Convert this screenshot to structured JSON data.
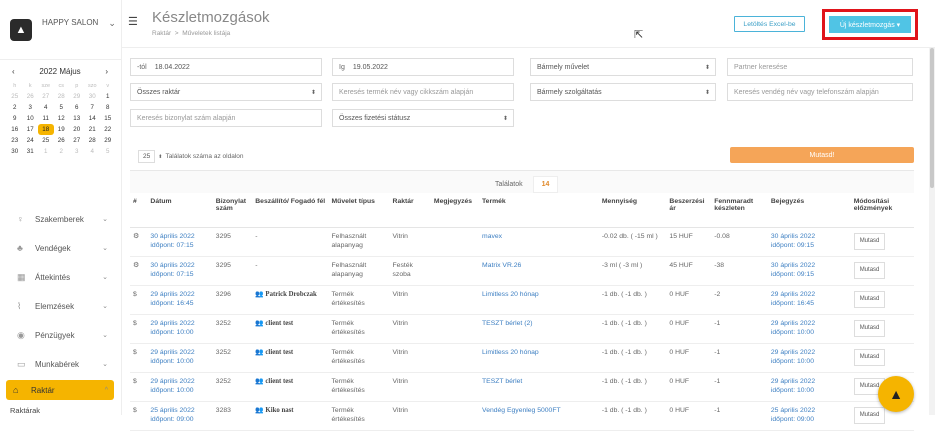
{
  "brand": {
    "name": "HAPPY SALON",
    "chevron": "⌄"
  },
  "calendar": {
    "month": "2022 Május",
    "prev": "‹",
    "next": "›",
    "weekdays": [
      "h",
      "k",
      "sze",
      "cs",
      "p",
      "szo",
      "v"
    ],
    "days": [
      [
        "25",
        "26",
        "27",
        "28",
        "29",
        "30",
        "1"
      ],
      [
        "2",
        "3",
        "4",
        "5",
        "6",
        "7",
        "8"
      ],
      [
        "9",
        "10",
        "11",
        "12",
        "13",
        "14",
        "15"
      ],
      [
        "16",
        "17",
        "18",
        "19",
        "20",
        "21",
        "22"
      ],
      [
        "23",
        "24",
        "25",
        "26",
        "27",
        "28",
        "29"
      ],
      [
        "30",
        "31",
        "1",
        "2",
        "3",
        "4",
        "5"
      ]
    ],
    "selected": "18"
  },
  "nav": [
    {
      "label": "Szakemberek",
      "icon": "person-icon"
    },
    {
      "label": "Vendégek",
      "icon": "group-icon"
    },
    {
      "label": "Áttekintés",
      "icon": "grid-icon"
    },
    {
      "label": "Elemzések",
      "icon": "chart-icon"
    },
    {
      "label": "Pénzügyek",
      "icon": "money-icon"
    },
    {
      "label": "Munkabérek",
      "icon": "wallet-icon"
    },
    {
      "label": "Raktár",
      "icon": "warehouse-icon",
      "active": true
    }
  ],
  "nav_sub": "Raktárak",
  "header": {
    "title": "Készletmozgások",
    "crumb1": "Raktár",
    "crumb_sep": ">",
    "crumb2": "Műveletek listája",
    "excel_btn": "Letöltés Excel-be",
    "new_btn": "Új készletmozgás ▾"
  },
  "filters": {
    "from_label": "-tól",
    "from_value": "18.04.2022",
    "to_label": "Ig",
    "to_value": "19.05.2022",
    "action": "Bármely művelet",
    "partner_ph": "Partner keresése",
    "warehouse": "Összes raktár",
    "product_ph": "Keresés termék név vagy cikkszám alapján",
    "service": "Bármely szolgáltatás",
    "guest_ph": "Keresés vendég név vagy telefonszám alapján",
    "receipt_ph": "Keresés bizonylat szám alapján",
    "payment": "Összes fizetési státusz"
  },
  "perpage": {
    "value": "25",
    "label": "Találatok száma az oldalon"
  },
  "show_btn": "Mutasd!",
  "results": {
    "label": "Találatok",
    "count": "14"
  },
  "columns": [
    "#",
    "Dátum",
    "Bizonylat szám",
    "Beszállító/ Fogadó fél",
    "Művelet típus",
    "Raktár",
    "Megjegyzés",
    "Termék",
    "Mennyiség",
    "Beszerzési ár",
    "Fennmaradt készleten",
    "Bejegyzés",
    "Módosítási előzmények"
  ],
  "rows": [
    {
      "ic": "⚙",
      "date": "30 április 2022",
      "time": "időpont: 07:15",
      "doc": "3295",
      "party": "-",
      "op": "Felhasznált alapanyag",
      "wh": "Vitrin",
      "note": "",
      "prod": "mavex",
      "qty": "-0.02 db. ( -15 ml )",
      "price": "15 HUF",
      "rem": "-0.08",
      "entry": "30 április 2022",
      "etime": "időpont: 09:15",
      "mod": "Mutasd"
    },
    {
      "ic": "⚙",
      "date": "30 április 2022",
      "time": "időpont: 07:15",
      "doc": "3295",
      "party": "-",
      "op": "Felhasznált alapanyag",
      "wh": "Festék szoba",
      "note": "",
      "prod": "Matrix VR.26",
      "qty": "-3 ml ( -3 ml )",
      "price": "45 HUF",
      "rem": "-38",
      "entry": "30 április 2022",
      "etime": "időpont: 09:15",
      "mod": "Mutasd"
    },
    {
      "ic": "$",
      "date": "29 április 2022",
      "time": "időpont: 16:45",
      "doc": "3296",
      "party": "👥 Patrick Drobczak",
      "op": "Termék értékesítés",
      "wh": "Vitrin",
      "note": "",
      "prod": "Limitless 20 hónap",
      "qty": "-1 db. ( -1 db. )",
      "price": "0 HUF",
      "rem": "-2",
      "entry": "29 április 2022",
      "etime": "időpont: 16:45",
      "mod": "Mutasd"
    },
    {
      "ic": "$",
      "date": "29 április 2022",
      "time": "időpont: 10:00",
      "doc": "3252",
      "party": "👥 client test",
      "op": "Termék értékesítés",
      "wh": "Vitrin",
      "note": "",
      "prod": "TESZT bérlet (2)",
      "qty": "-1 db. ( -1 db. )",
      "price": "0 HUF",
      "rem": "-1",
      "entry": "29 április 2022",
      "etime": "időpont: 10:00",
      "mod": "Mutasd"
    },
    {
      "ic": "$",
      "date": "29 április 2022",
      "time": "időpont: 10:00",
      "doc": "3252",
      "party": "👥 client test",
      "op": "Termék értékesítés",
      "wh": "Vitrin",
      "note": "",
      "prod": "Limitless 20 hónap",
      "qty": "-1 db. ( -1 db. )",
      "price": "0 HUF",
      "rem": "-1",
      "entry": "29 április 2022",
      "etime": "időpont: 10:00",
      "mod": "Mutasd"
    },
    {
      "ic": "$",
      "date": "29 április 2022",
      "time": "időpont: 10:00",
      "doc": "3252",
      "party": "👥 client test",
      "op": "Termék értékesítés",
      "wh": "Vitrin",
      "note": "",
      "prod": "TESZT bérlet",
      "qty": "-1 db. ( -1 db. )",
      "price": "0 HUF",
      "rem": "-1",
      "entry": "29 április 2022",
      "etime": "időpont: 10:00",
      "mod": "Mutasd"
    },
    {
      "ic": "$",
      "date": "25 április 2022",
      "time": "időpont: 09:00",
      "doc": "3283",
      "party": "👥 Kiko nast",
      "op": "Termék értékesítés",
      "wh": "Vitrin",
      "note": "",
      "prod": "Vendég Egyenleg 5000FT",
      "qty": "-1 db. ( -1 db. )",
      "price": "0 HUF",
      "rem": "-1",
      "entry": "25 április 2022",
      "etime": "időpont: 09:00",
      "mod": "Mutasd"
    }
  ]
}
